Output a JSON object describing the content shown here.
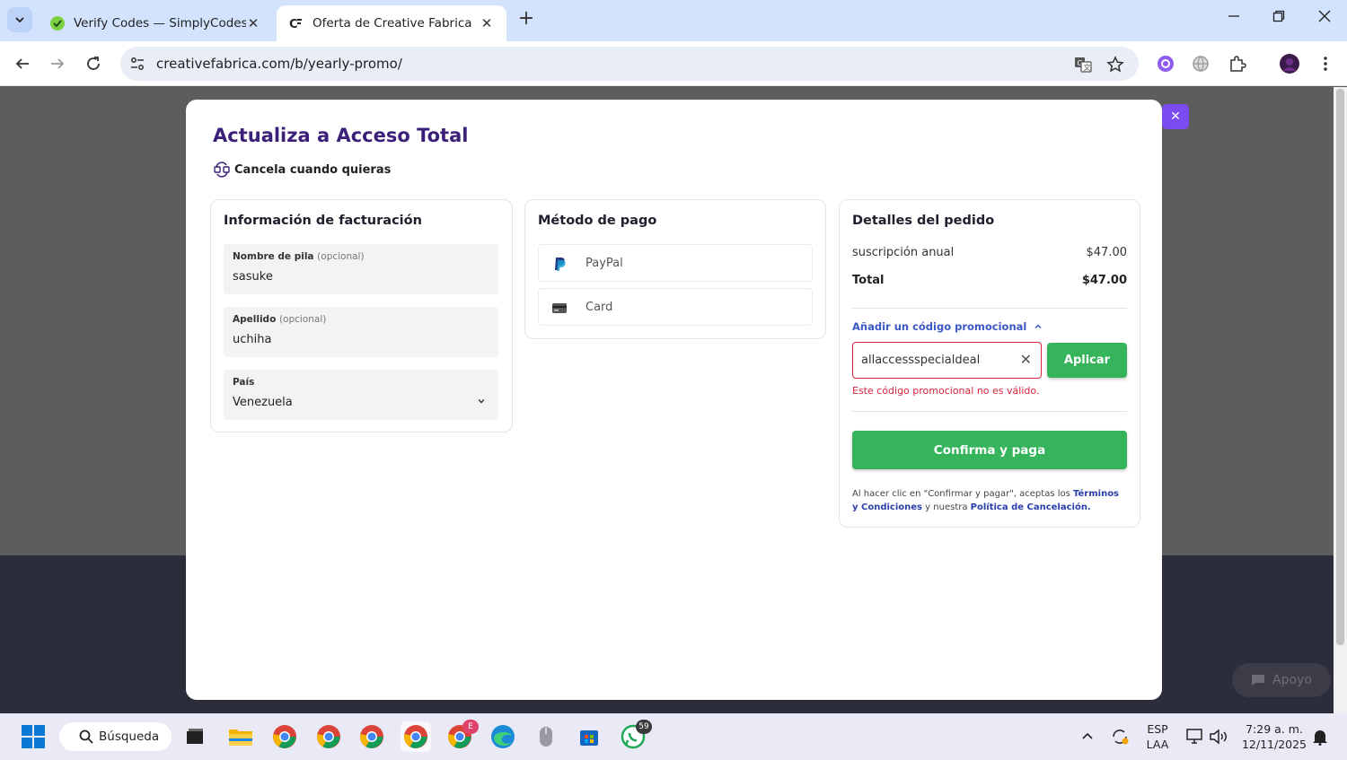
{
  "browser": {
    "tabs": [
      {
        "title": "Verify Codes — SimplyCodes",
        "active": false
      },
      {
        "title": "Oferta de Creative Fabrica",
        "active": true
      }
    ],
    "url": "creativefabrica.com/b/yearly-promo/"
  },
  "modal": {
    "title": "Actualiza a Acceso Total",
    "cancel_note": "Cancela cuando quieras",
    "billing": {
      "heading": "Información de facturación",
      "first_name": {
        "label": "Nombre de pila",
        "optional": "(opcional)",
        "value": "sasuke"
      },
      "last_name": {
        "label": "Apellido",
        "optional": "(opcional)",
        "value": "uchiha"
      },
      "country": {
        "label": "País",
        "value": "Venezuela"
      }
    },
    "payment": {
      "heading": "Método de pago",
      "options": [
        {
          "label": "PayPal",
          "icon": "paypal-icon"
        },
        {
          "label": "Card",
          "icon": "card-icon"
        }
      ]
    },
    "order": {
      "heading": "Detalles del pedido",
      "line_item": {
        "label": "suscripción anual",
        "price": "$47.00"
      },
      "total": {
        "label": "Total",
        "price": "$47.00"
      },
      "promo_toggle": "Añadir un código promocional",
      "promo_code": "allaccessspecialdeal",
      "apply_label": "Aplicar",
      "promo_error": "Este código promocional no es válido.",
      "confirm_label": "Confirma y paga",
      "terms_prefix": "Al hacer clic en \"Confirmar y pagar\", aceptas los ",
      "terms_link": "Términos y Condiciones",
      "terms_middle": " y nuestra ",
      "cancel_policy_link": "Política de Cancelación."
    }
  },
  "support_label": "Apoyo",
  "taskbar": {
    "search_label": "Búsqueda",
    "whatsapp_badge": "59",
    "chrome_badge_e": "E",
    "lang_top": "ESP",
    "lang_bottom": "LAA",
    "time": "7:29 a. m.",
    "date": "12/11/2025"
  },
  "colors": {
    "brand_purple": "#3b1f78",
    "accent_green": "#35b45b",
    "error_red": "#d6243b",
    "close_purple": "#7b4bf0"
  }
}
